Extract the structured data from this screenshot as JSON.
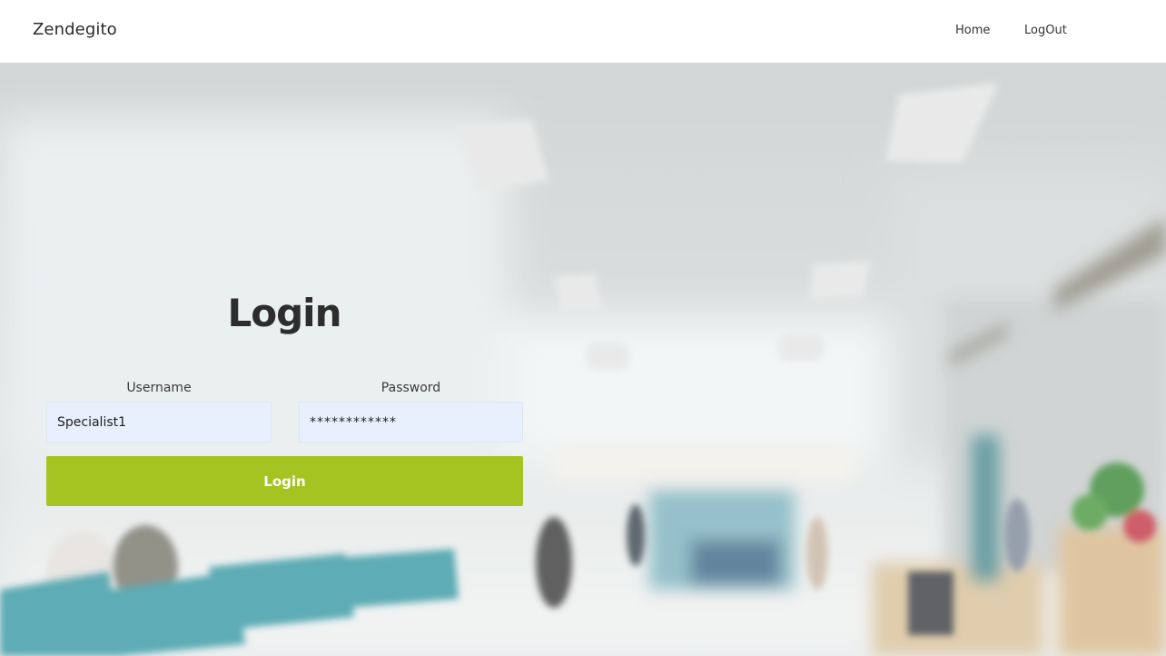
{
  "header": {
    "brand": "Zendegito",
    "nav": [
      {
        "label": "Home"
      },
      {
        "label": "LogOut"
      }
    ]
  },
  "login": {
    "title": "Login",
    "username": {
      "label": "Username",
      "value": "Specialist1"
    },
    "password": {
      "label": "Password",
      "value": "************"
    },
    "button_label": "Login"
  },
  "colors": {
    "accent": "#a5c422",
    "input_bg": "#e8f0fe",
    "header_bg": "#ffffff"
  }
}
